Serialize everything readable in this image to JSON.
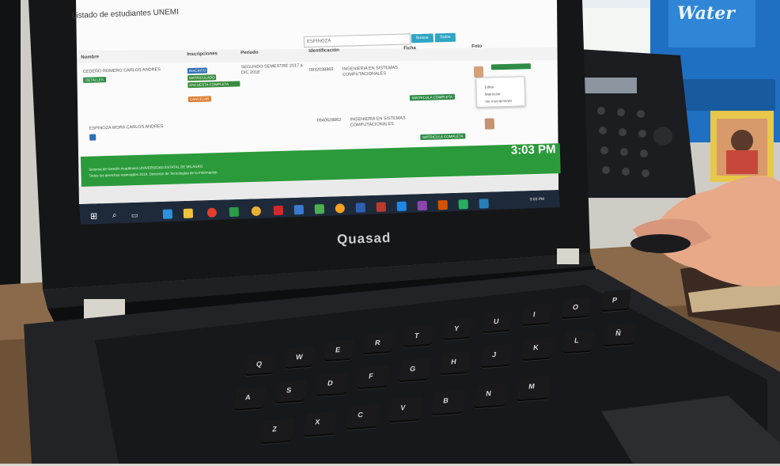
{
  "screen": {
    "page_title": "Listado de estudiantes UNEMI",
    "search_value": "ESPINOZA",
    "search_button": "Buscar",
    "clear_button": "Todos",
    "columns": [
      "Nombre",
      "Inscripciones",
      "Período",
      "Identificación",
      "Ficha",
      "Foto"
    ],
    "rows": [
      {
        "name": "CEDEÑO ROMERO CARLOS ANDRES",
        "action": "DETALLES",
        "badges": [
          "INSCRITO",
          "MATRICULADO",
          "ENCUESTA COMPLETA",
          "CANCELAR"
        ],
        "period": "SEGUNDO SEMESTRE 2017 a DIC 2018",
        "id": "0932038865",
        "career": "INGENIERIA EN SISTEMAS COMPUTACIONALES",
        "status": "MATRICULA COMPLETA"
      },
      {
        "name": "ESPINOZA MORA CARLOS ANDRES",
        "id": "0940628862",
        "career": "INGENIERIA EN SISTEMAS COMPUTACIONALES",
        "status": "MATRICULA COMPLETA"
      }
    ],
    "dropdown_items": [
      "Editar",
      "Matricular",
      "Ver Inscripciones"
    ],
    "footer_line1": "Sistema de Gestión Académica UNIVERSIDAD ESTATAL DE MILAGRO",
    "footer_line2": "Todos los derechos reservados 2019. Dirección de Tecnologías de la Información",
    "clock": "3:03 PM",
    "taskbar_date": "3:03 PM"
  },
  "laptop_brand": "Quasad",
  "colors": {
    "footer_green": "#2b9a3b",
    "button_blue": "#2fa5c4",
    "bottle_blue": "#1f6fc2"
  },
  "bottle_label": "Water",
  "keyboard_keys": [
    "Q",
    "W",
    "E",
    "R",
    "T",
    "Y",
    "U",
    "I",
    "O",
    "P",
    "A",
    "S",
    "D",
    "F",
    "G",
    "H",
    "J",
    "K",
    "L",
    "Ñ",
    "Z",
    "X",
    "C",
    "V",
    "B",
    "N",
    "M"
  ]
}
